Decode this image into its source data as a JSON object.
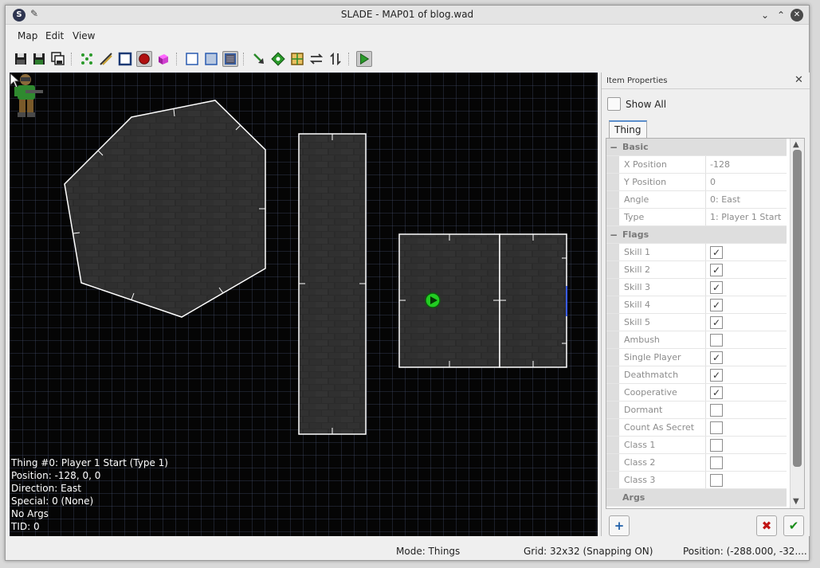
{
  "window": {
    "title": "SLADE - MAP01 of blog.wad"
  },
  "menu": {
    "items": [
      "Map",
      "Edit",
      "View"
    ]
  },
  "toolbar": {
    "icons": [
      "save-icon",
      "save-as-icon",
      "save-all-icon",
      "vertices-mode-icon",
      "lines-mode-icon",
      "sectors-mode-icon",
      "things-mode-icon",
      "3d-mode-icon",
      "normal-sector-edit-icon",
      "floor-edit-icon",
      "ceiling-edit-icon",
      "draw-line-icon",
      "node-builder-icon",
      "texture-icon",
      "flip-horizontal-icon",
      "flip-vertical-icon",
      "run-map-icon"
    ]
  },
  "map_info": {
    "line1": "Thing #0: Player 1 Start (Type 1)",
    "line2": "Position: -128, 0, 0",
    "line3": "Direction: East",
    "line4": "Special: 0 (None)",
    "line5": "No Args",
    "line6": "TID: 0"
  },
  "props": {
    "title": "Item Properties",
    "show_all": "Show All",
    "tab": "Thing",
    "categories": {
      "basic": "Basic",
      "flags": "Flags",
      "args": "Args"
    },
    "basic": [
      {
        "name": "X Position",
        "value": "-128"
      },
      {
        "name": "Y Position",
        "value": "0"
      },
      {
        "name": "Angle",
        "value": "0: East"
      },
      {
        "name": "Type",
        "value": "1: Player 1 Start"
      }
    ],
    "flags": [
      {
        "name": "Skill 1",
        "checked": true
      },
      {
        "name": "Skill 2",
        "checked": true
      },
      {
        "name": "Skill 3",
        "checked": true
      },
      {
        "name": "Skill 4",
        "checked": true
      },
      {
        "name": "Skill 5",
        "checked": true
      },
      {
        "name": "Ambush",
        "checked": false
      },
      {
        "name": "Single Player",
        "checked": true
      },
      {
        "name": "Deathmatch",
        "checked": true
      },
      {
        "name": "Cooperative",
        "checked": true
      },
      {
        "name": "Dormant",
        "checked": false
      },
      {
        "name": "Count As Secret",
        "checked": false
      },
      {
        "name": "Class 1",
        "checked": false
      },
      {
        "name": "Class 2",
        "checked": false
      },
      {
        "name": "Class 3",
        "checked": false
      }
    ]
  },
  "status": {
    "mode": "Mode: Things",
    "grid": "Grid: 32x32 (Snapping ON)",
    "position": "Position: (-288.000, -32...."
  },
  "colors": {
    "map_background": "#050505",
    "grid": "#2c3348",
    "sector_line": "#ffffff",
    "player_thing": "#22cc22",
    "accent_blue": "#5a8ecb"
  }
}
